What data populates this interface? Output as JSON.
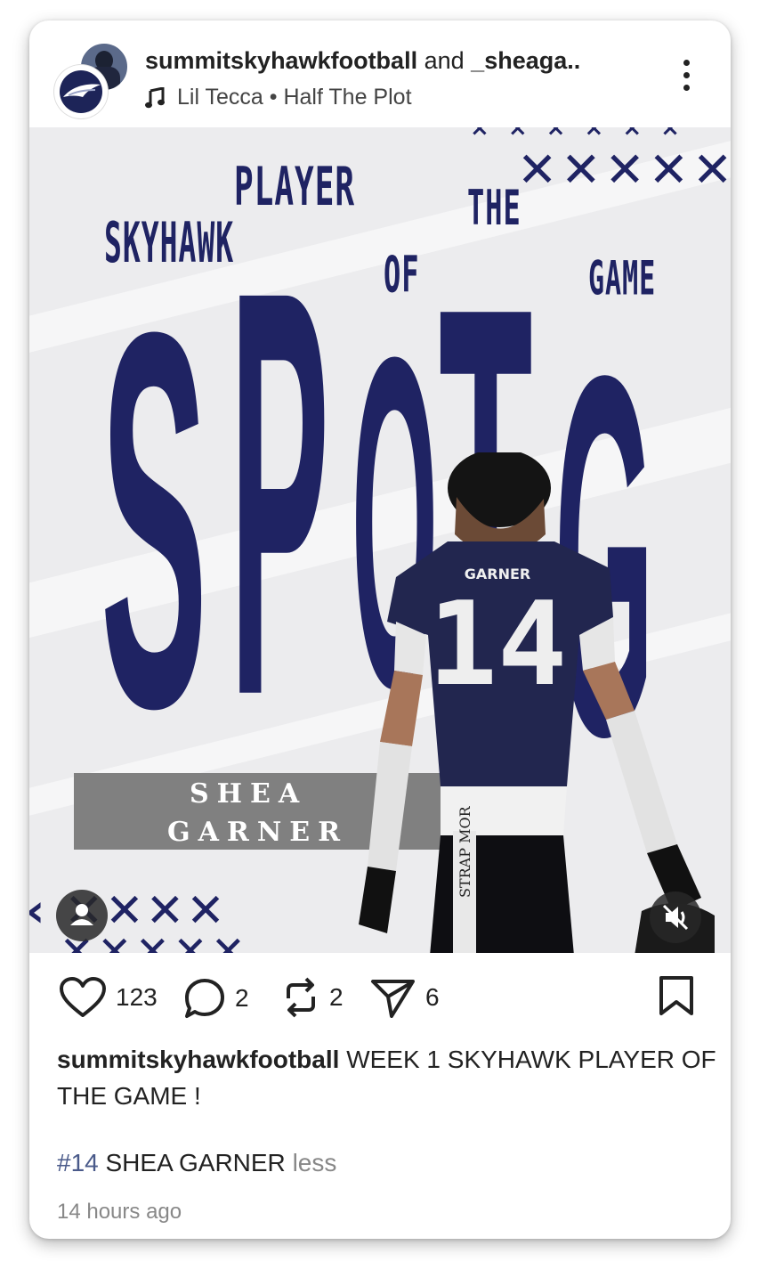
{
  "post": {
    "author": "summitskyhawkfootball",
    "connector": "and",
    "coauthor": "_sheaga..",
    "music": "Lil Tecca • Half The Plot"
  },
  "graphic": {
    "words": [
      "SKYHAWK",
      "PLAYER",
      "OF",
      "THE",
      "GAME"
    ],
    "acronym": [
      "S",
      "P",
      "O",
      "T",
      "G"
    ],
    "player_first": "SHEA",
    "player_last": "GARNER",
    "jersey_name": "GARNER",
    "jersey_number": "14"
  },
  "stats": {
    "likes": "123",
    "comments": "2",
    "reposts": "2",
    "shares": "6"
  },
  "caption": {
    "author": "summitskyhawkfootball",
    "text": "WEEK 1 SKYHAWK PLAYER OF THE GAME !",
    "hashtag": "#14",
    "line2": "SHEA GARNER",
    "less": "less"
  },
  "timestamp": "14 hours ago",
  "colors": {
    "navy": "#1f2363",
    "plate": "#808080",
    "muted": "#888888"
  },
  "icons": [
    "heart-icon",
    "comment-icon",
    "repost-icon",
    "share-icon",
    "bookmark-icon",
    "more-icon",
    "music-note-icon",
    "user-tag-icon",
    "mute-icon"
  ]
}
